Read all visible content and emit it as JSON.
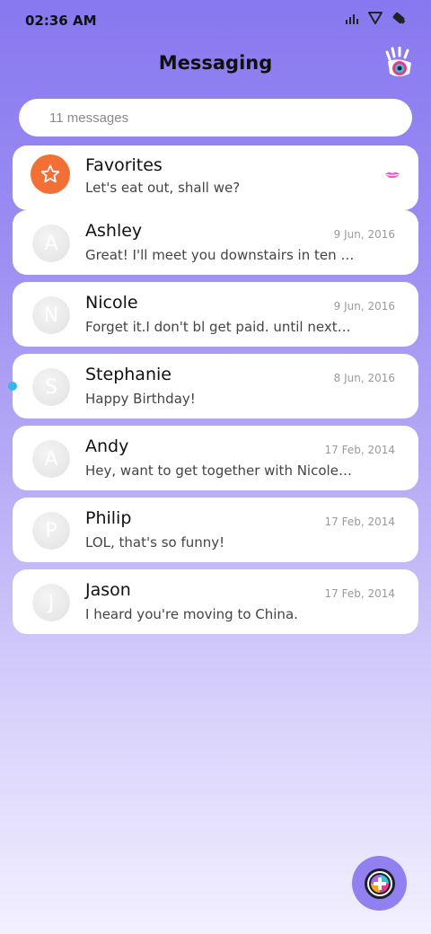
{
  "status_bar": {
    "time": "02:36 AM",
    "icons": [
      "signal-icon",
      "wifi-icon",
      "battery-icon"
    ]
  },
  "header": {
    "title": "Messaging",
    "logo_icon": "hand-eye-logo-icon"
  },
  "search": {
    "placeholder": "11 messages"
  },
  "favorites": {
    "name": "Favorites",
    "preview": "Let's eat out, shall we?",
    "icon": "star-icon",
    "badge_icon": "lips-icon",
    "accent_color": "#f26f35"
  },
  "conversations": [
    {
      "initial": "A",
      "name": "Ashley",
      "preview": "Great! I'll meet you downstairs in ten minutes.",
      "date": "9 Jun, 2016",
      "unread": false
    },
    {
      "initial": "N",
      "name": "Nicole",
      "preview": "Forget it.I don't bl get paid. until next Friday.",
      "date": "9 Jun, 2016",
      "unread": false
    },
    {
      "initial": "S",
      "name": "Stephanie",
      "preview": "Happy Birthday!",
      "date": "8 Jun, 2016",
      "unread": true
    },
    {
      "initial": "A",
      "name": "Andy",
      "preview": "Hey, want to get together with Nicole on Saturday?",
      "date": "17 Feb, 2014",
      "unread": false
    },
    {
      "initial": "P",
      "name": "Philip",
      "preview": "LOL, that's so funny!",
      "date": "17 Feb, 2014",
      "unread": false
    },
    {
      "initial": "J",
      "name": "Jason",
      "preview": "I heard you're moving to China.",
      "date": "17 Feb, 2014",
      "unread": false
    }
  ],
  "fab": {
    "icon": "compose-plus-icon"
  },
  "colors": {
    "background_top": "#8878f0",
    "background_bottom": "#f3f0fe",
    "unread_dot": "#2fb8f0",
    "fab": "#9180f0"
  }
}
